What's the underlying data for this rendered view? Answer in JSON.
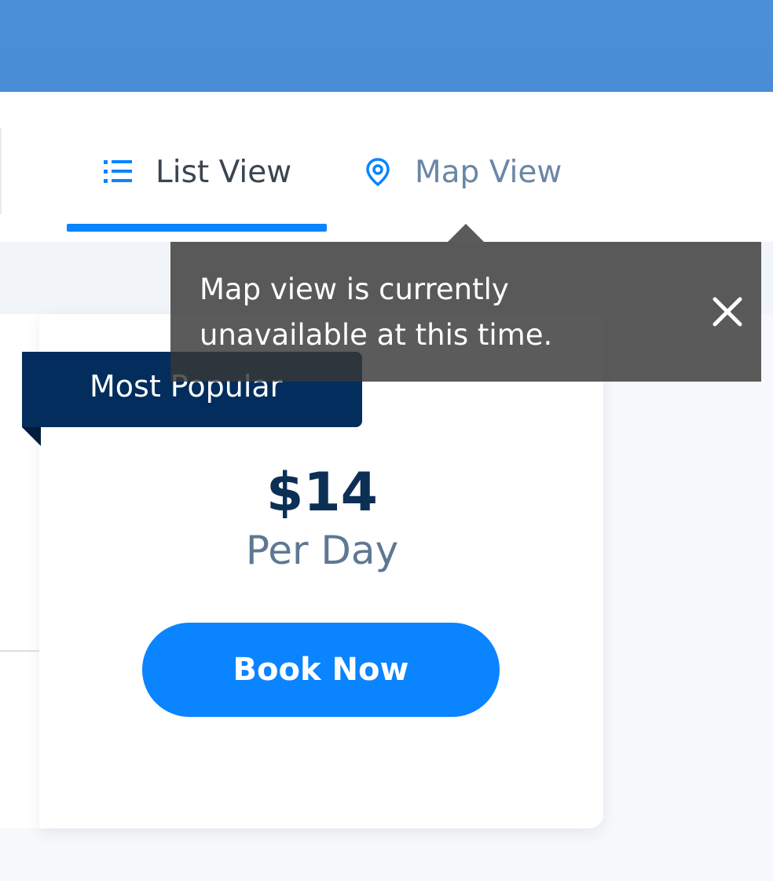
{
  "tabs": {
    "list_view": {
      "label": "List View",
      "icon": "list-icon",
      "active": true
    },
    "map_view": {
      "label": "Map View",
      "icon": "map-pin-icon",
      "active": false
    }
  },
  "tooltip": {
    "message": "Map view is currently unavailable at this time.",
    "close_icon": "close-icon"
  },
  "card": {
    "ribbon_label": "Most Popular",
    "price": "$14",
    "period": "Per Day",
    "cta_label": "Book Now"
  },
  "colors": {
    "header_blue": "#4a90d9",
    "accent_blue": "#0a84ff",
    "navy": "#032d5c",
    "tooltip_bg": "#373737",
    "price_text": "#0c2f56",
    "muted_text": "#5e7894"
  }
}
